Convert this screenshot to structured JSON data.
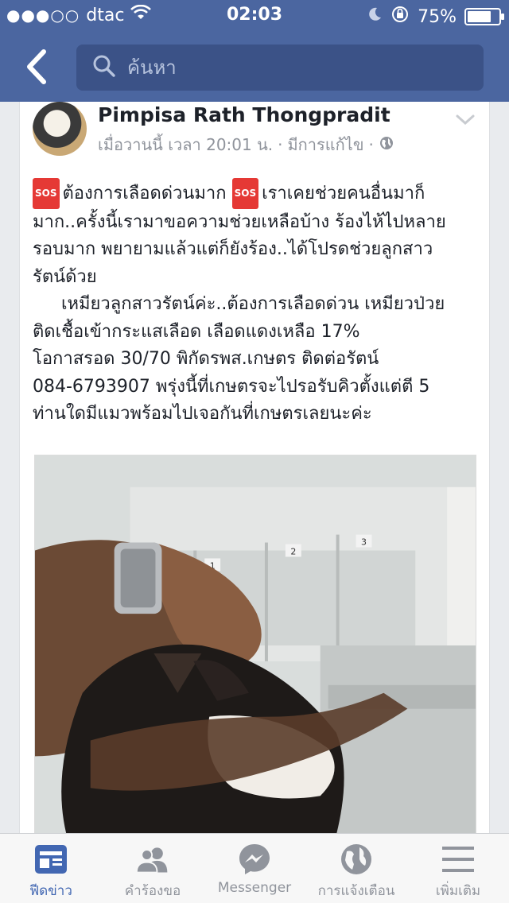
{
  "status_bar": {
    "carrier": "dtac",
    "signal_dots": "●●●○○",
    "time": "02:03",
    "battery_percent": "75%",
    "battery_level": 0.75
  },
  "nav": {
    "search_placeholder": "ค้นหา"
  },
  "post": {
    "author": "Pimpisa Rath Thongpradit",
    "timestamp": "เมื่อวานนี้ เวลา 20:01 น.",
    "edited": "มีการแก้ไข",
    "separator": "·",
    "sos_label": "SOS",
    "lines": {
      "l1a": "ต้องการเลือดด่วนมาก",
      "l1b": "เราเคยช่วยคนอื่นมาก็",
      "l2": "มาก..ครั้งนี้เรามาขอความช่วยเหลือบ้าง ร้องไห้ไปหลาย",
      "l3": "รอบมาก พยายามแล้วแต่ก็ยังร้อง..ได้โปรดช่วยลูกสาว",
      "l4": "รัตน์ด้วย",
      "l5": "เหมียวลูกสาวรัตน์ค่ะ..ต้องการเลือดด่วน เหมียวป่วย",
      "l6": "ติดเชื้อเข้ากระแสเลือด เลือดแดงเหลือ 17%",
      "l7": "โอกาสรอด 30/70 พิกัดรพส.เกษตร ติดต่อรัตน์",
      "l8": "084-6793907 พรุ่งนี้ที่เกษตรจะไปรอรับคิวตั้งแต่ตี 5",
      "l9": "ท่านใดมีแมวพร้อมไปเจอกันที่เกษตรเลยนะค่ะ"
    },
    "photo_labels": [
      "1",
      "2",
      "3"
    ]
  },
  "tabbar": {
    "items": [
      {
        "label": "ฟีดข่าว",
        "icon": "news-feed-icon",
        "active": true
      },
      {
        "label": "คำร้องขอ",
        "icon": "friend-requests-icon",
        "active": false
      },
      {
        "label": "Messenger",
        "icon": "messenger-icon",
        "active": false
      },
      {
        "label": "การแจ้งเตือน",
        "icon": "globe-notifications-icon",
        "active": false
      },
      {
        "label": "เพิ่มเติม",
        "icon": "menu-icon",
        "active": false
      }
    ]
  },
  "colors": {
    "brand_blue": "#4b66a0",
    "active_tab": "#4267b2",
    "inactive_tab": "#90949c"
  }
}
